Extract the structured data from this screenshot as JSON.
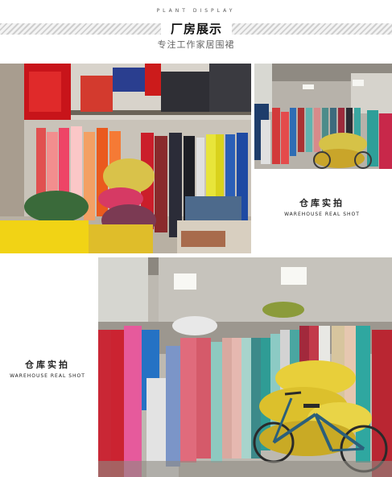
{
  "header": {
    "top_caption": "PLANT DISPLAY",
    "title": "厂房展示",
    "subtitle": "专注工作家居围裙"
  },
  "captions": {
    "right": {
      "cn": "仓库实拍",
      "en": "WAREHOUSE REAL SHOT"
    },
    "left": {
      "cn": "仓库实拍",
      "en": "WAREHOUSE REAL SHOT"
    }
  },
  "images": {
    "photo1": "warehouse-shelves-photo",
    "photo2": "warehouse-corridor-photo",
    "photo3": "warehouse-bicycle-photo"
  },
  "colors": {
    "band_light": "#f4f4f4",
    "band_dark": "#cfcfcf",
    "text": "#222222"
  }
}
